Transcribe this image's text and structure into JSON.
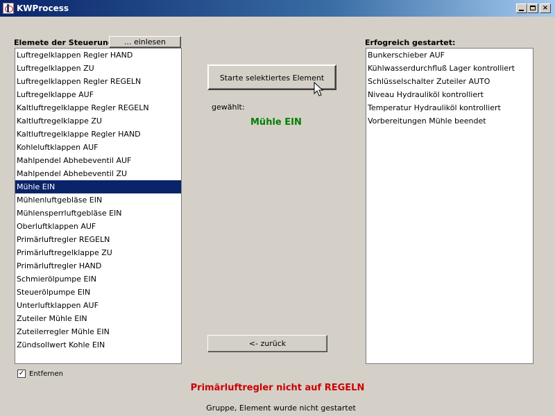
{
  "window": {
    "title": "KWProcess"
  },
  "left_panel": {
    "header": "Elemete der Steuerung",
    "read_button": "... einlesen",
    "items": [
      "Luftregelklappen Regler HAND",
      "Luftregelklappen ZU",
      "Luftregelklappen Regler REGELN",
      "Luftregelklappe AUF",
      "Kaltluftregelklappe Regler REGELN",
      "Kaltluftregelklappe ZU",
      "Kaltluftregelklappe Regler HAND",
      "Kohleluftklappen AUF",
      "Mahlpendel Abhebeventil AUF",
      "Mahlpendel Abhebeventil ZU",
      "Mühle EIN",
      "Mühlenluftgebläse EIN",
      "Mühlensperrluftgebläse EIN",
      "Oberluftklappen AUF",
      "Primärluftregler REGELN",
      "Primärluftregelklappe ZU",
      "Primärluftregler HAND",
      "Schmierölpumpe EIN",
      "Steuerölpumpe EIN",
      "Unterluftklappen AUF",
      "Zuteiler Mühle EIN",
      "Zuteilerregler Mühle EIN",
      "Zündsollwert Kohle EIN"
    ],
    "selected_index": 10
  },
  "center": {
    "start_button": "Starte selektiertes Element",
    "chosen_label": "gewählt:",
    "chosen_value": "Mühle EIN",
    "back_button": "<- zurück"
  },
  "right_panel": {
    "header": "Erfogreich gestartet:",
    "items": [
      "Bunkerschieber AUF",
      "Kühlwasserdurchfluß Lager kontrolliert",
      "Schlüsselschalter Zuteiler AUTO",
      "Niveau Hydrauliköl kontrolliert",
      "Temperatur Hydrauliköl kontrolliert",
      "Vorbereitungen Mühle beendet"
    ]
  },
  "remove_checkbox": {
    "label": "Entfernen",
    "checked": true
  },
  "status": {
    "error_message": "Primärluftregler nicht auf REGELN",
    "info_message": "Gruppe, Element wurde nicht gestartet"
  },
  "colors": {
    "title_bar": "#0a246a",
    "selection": "#0a246a",
    "chosen_value": "#008000",
    "error": "#cc0000"
  }
}
